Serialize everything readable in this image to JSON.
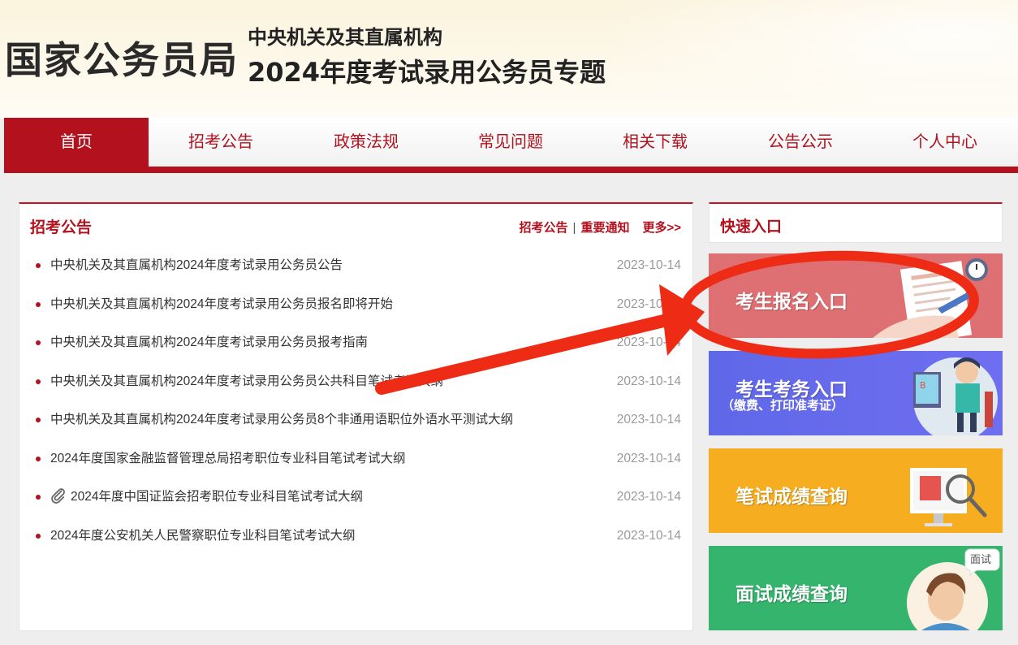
{
  "header": {
    "logo": "国家公务员局",
    "subtitle_line1": "中央机关及其直属机构",
    "subtitle_line2": "2024年度考试录用公务员专题"
  },
  "nav": {
    "items": [
      "首页",
      "招考公告",
      "政策法规",
      "常见问题",
      "相关下载",
      "公告公示",
      "个人中心"
    ],
    "active_index": 0
  },
  "announcements": {
    "title": "招考公告",
    "links": {
      "announcements": "招考公告",
      "separator": "|",
      "notices": "重要通知",
      "more": "更多>>"
    },
    "items": [
      {
        "title": "中央机关及其直属机构2024年度考试录用公务员公告",
        "date": "2023-10-14"
      },
      {
        "title": "中央机关及其直属机构2024年度考试录用公务员报名即将开始",
        "date": "2023-10-14"
      },
      {
        "title": "中央机关及其直属机构2024年度考试录用公务员报考指南",
        "date": "2023-10-14"
      },
      {
        "title": "中央机关及其直属机构2024年度考试录用公务员公共科目笔试考试大纲",
        "date": "2023-10-14"
      },
      {
        "title": "中央机关及其直属机构2024年度考试录用公务员8个非通用语职位外语水平测试大纲",
        "date": "2023-10-14"
      },
      {
        "title": "2024年度国家金融监督管理总局招考职位专业科目笔试考试大纲",
        "date": "2023-10-14"
      },
      {
        "title": "2024年度中国证监会招考职位专业科目笔试考试大纲",
        "date": "2023-10-14",
        "icon": "paperclip-icon"
      },
      {
        "title": "2024年度公安机关人民警察职位专业科目笔试考试大纲",
        "date": "2023-10-14"
      }
    ]
  },
  "quick_entry": {
    "title": "快速入口",
    "entries": [
      {
        "label": "考生报名入口",
        "color": "#de6f73",
        "icon": "form-signing-icon"
      },
      {
        "label": "考生考务入口",
        "sub": "（缴费、打印准考证）",
        "color": "#6b6fe8",
        "icon": "student-computer-icon"
      },
      {
        "label": "笔试成绩查询",
        "color": "#f6ad1f",
        "icon": "monitor-magnifier-icon"
      },
      {
        "label": "面试成绩查询",
        "color": "#34b46c",
        "icon": "interviewer-avatar-icon",
        "badge": "面试"
      }
    ]
  },
  "colors": {
    "brand_red": "#b3111e",
    "annotation_red": "#ee2c16"
  }
}
